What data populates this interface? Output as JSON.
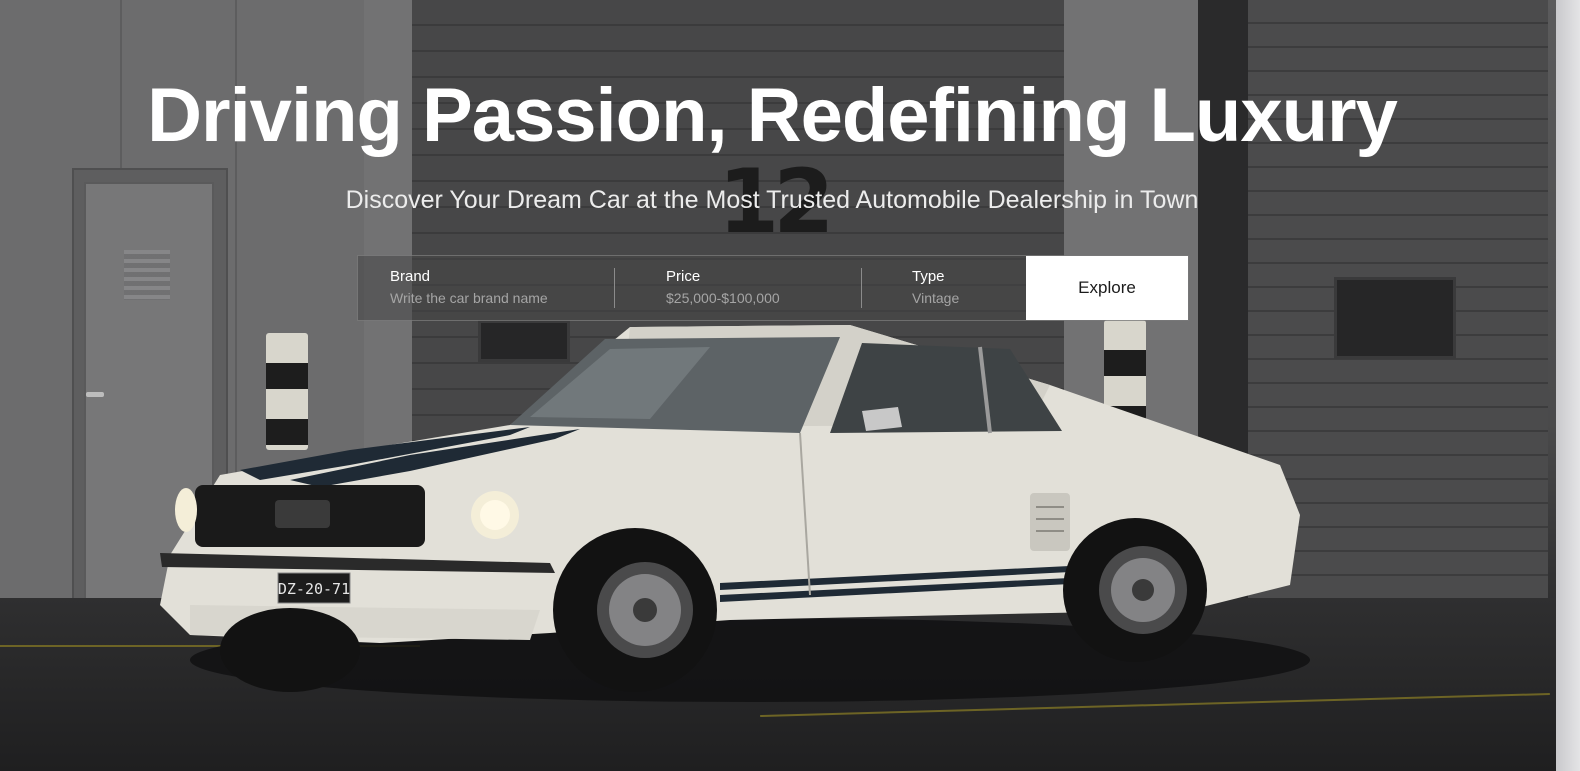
{
  "hero": {
    "headline": "Driving Passion, Redefining Luxury",
    "subheadline": "Discover Your Dream Car at the Most Trusted Automobile Dealership in Town",
    "background_number": "12",
    "license_plate": "DZ-20-71"
  },
  "search": {
    "brand": {
      "label": "Brand",
      "placeholder": "Write the car brand name"
    },
    "price": {
      "label": "Price",
      "placeholder": "$25,000-$100,000"
    },
    "type": {
      "label": "Type",
      "placeholder": "Vintage"
    },
    "explore_label": "Explore"
  },
  "icons": {
    "vehicle": "car-image"
  },
  "colors": {
    "button_bg": "#ffffff",
    "text_primary": "#ffffff",
    "placeholder": "#a5a5a5"
  }
}
